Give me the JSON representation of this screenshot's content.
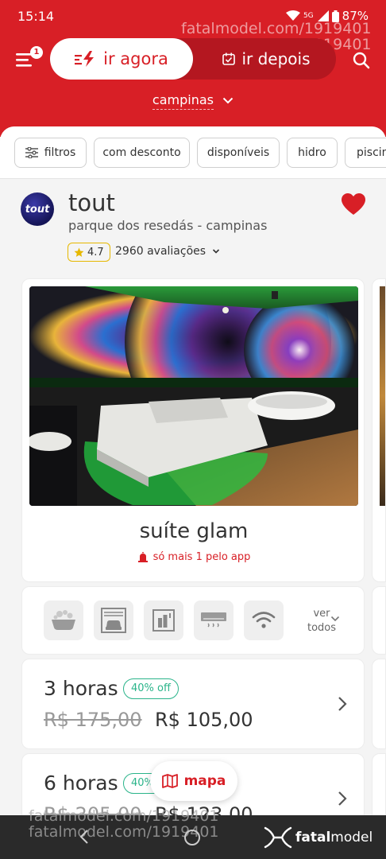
{
  "status_bar": {
    "time": "15:14",
    "network": "5G",
    "battery": "87%"
  },
  "header": {
    "notification_count": "1",
    "toggle": {
      "now_label": "ir agora",
      "later_label": "ir depois"
    },
    "city": "campinas"
  },
  "watermark": {
    "line1": "fatalmodel.com/1919401",
    "line2": "fatalmodel.com/1919401"
  },
  "filters": [
    {
      "label": "filtros",
      "icon": "sliders-icon"
    },
    {
      "label": "com desconto"
    },
    {
      "label": "disponíveis"
    },
    {
      "label": "hidro"
    },
    {
      "label": "piscina"
    }
  ],
  "motel": {
    "logo_text": "tout",
    "name": "tout",
    "location": "parque dos resedás - campinas",
    "rating": "4.7",
    "reviews": "2960 avaliações",
    "favorited": true
  },
  "room": {
    "name": "suíte glam",
    "alert": "só mais 1 pelo app"
  },
  "amenities": {
    "icons": [
      "bathtub-icon",
      "garage-icon",
      "minibar-icon",
      "air-conditioner-icon",
      "wifi-icon"
    ],
    "see_all_line1": "ver",
    "see_all_line2": "todos"
  },
  "prices": [
    {
      "duration": "3 horas",
      "discount": "40% off",
      "old_price": "R$ 175,00",
      "new_price": "R$ 105,00"
    },
    {
      "duration": "6 horas",
      "discount": "40% off",
      "old_price": "R$ 205,00",
      "new_price": "R$ 123,00"
    }
  ],
  "map_button": {
    "label": "mapa"
  },
  "footer": {
    "brand_prefix": "fatal",
    "brand_suffix": "model",
    "watermark_line1": "fatalmodel.com/1919401",
    "watermark_line2": "fatalmodel.com/1919401"
  },
  "colors": {
    "brand_red": "#d81f26",
    "discount_green": "#2ab48a",
    "rating_yellow": "#e6b800"
  }
}
